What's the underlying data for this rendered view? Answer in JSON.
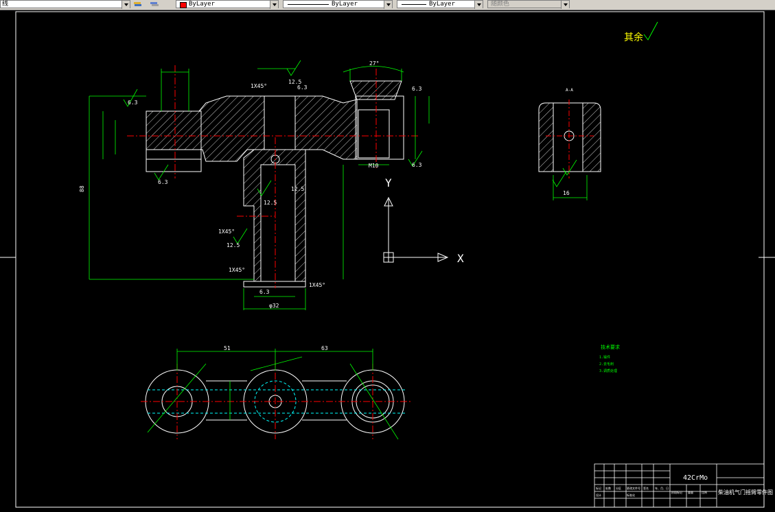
{
  "toolbar": {
    "layer_label": "线",
    "color_value": "ByLayer",
    "linetype_value": "ByLayer",
    "lineweight_value": "ByLayer",
    "plotstyle_value": "随颜色"
  },
  "drawing": {
    "roughness_note": "其余",
    "axis_y": "Y",
    "axis_x": "X",
    "material": "42CrMo",
    "title": "柴油机气门摇臂零件图",
    "dim_angle": "27°",
    "chamfer_1": "1X45°",
    "chamfer_2": "1X45°",
    "chamfer_3": "1X45°",
    "chamfer_4": "1X45°",
    "roughness_r1": "12.5",
    "roughness_r2": "12.5",
    "roughness_r3": "12.5",
    "roughness_r4": "12.5",
    "roughness_r5": "6.3",
    "roughness_r6": "6.3",
    "roughness_r7": "6.3",
    "roughness_r8": "6.3",
    "roughness_r9": "6.3",
    "roughness_r10": "6.3",
    "dim_top_left": "51",
    "dim_top_right": "63",
    "dim_m10": "M10",
    "dim_phi32": "φ32",
    "dim_16": "16",
    "dim_88": "88",
    "section_label": "A-A",
    "tech_title": "技术要求",
    "tech_line1": "1.锻件",
    "tech_line2": "2.去毛刺",
    "tech_line3": "3.调质处理",
    "tb_labels": [
      "标记",
      "处数",
      "分区",
      "更改文件号",
      "签名",
      "年、月、日",
      "设计",
      "标准化",
      "阶段标记",
      "重量",
      "比例"
    ]
  }
}
